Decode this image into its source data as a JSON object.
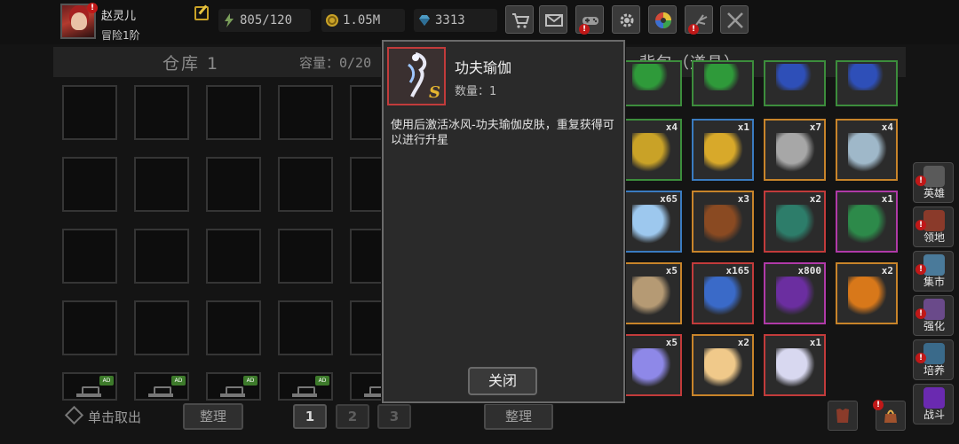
{
  "player": {
    "name": "赵灵儿",
    "rank": "冒险1阶"
  },
  "resources": {
    "stamina": "805/120",
    "gold": "1.05M",
    "gems": "3313"
  },
  "top_buttons": [
    "shop-cart-icon",
    "mail-icon",
    "gamepad-icon",
    "gear-icon",
    "color-wheel-icon",
    "fireworks-icon",
    "crossed-swords-icon"
  ],
  "warehouse": {
    "title": "仓库 1",
    "capacity_label": "容量：0/20",
    "take_out_hint": "单击取出",
    "sort_label": "整理",
    "pages": [
      "1",
      "2",
      "3"
    ],
    "ad_tag": "AD"
  },
  "backpack": {
    "title": "背包（道具）",
    "sort_label": "整理",
    "items": [
      {
        "qty": "",
        "icon": "green-gem-icon",
        "color": "#3c8d3c"
      },
      {
        "qty": "",
        "icon": "green-gem-icon",
        "color": "#3c8d3c"
      },
      {
        "qty": "",
        "icon": "blue-gem-icon",
        "color": "#3c8d3c"
      },
      {
        "qty": "",
        "icon": "blue-gem-icon",
        "color": "#3c8d3c"
      },
      {
        "qty": "x4",
        "icon": "gold-block-icon",
        "color": "#3c8d3c"
      },
      {
        "qty": "x1",
        "icon": "gold-diamond-icon",
        "color": "#3a7bc0"
      },
      {
        "qty": "x7",
        "icon": "grey-feather-icon",
        "color": "#c8842a"
      },
      {
        "qty": "x4",
        "icon": "silver-amulet-icon",
        "color": "#c8842a"
      },
      {
        "qty": "x65",
        "icon": "ice-crystal-icon",
        "color": "#3a7bc0"
      },
      {
        "qty": "x3",
        "icon": "brown-boots-icon",
        "color": "#c8842a"
      },
      {
        "qty": "x2",
        "icon": "green-boots-icon",
        "color": "#c23b3b"
      },
      {
        "qty": "x1",
        "icon": "teal-boots-icon",
        "color": "#b03aa8"
      },
      {
        "qty": "x5",
        "icon": "scroll-icon",
        "color": "#c8842a"
      },
      {
        "qty": "x165",
        "icon": "blue-rune-icon",
        "color": "#c23b3b"
      },
      {
        "qty": "x800",
        "icon": "purple-orb-icon",
        "color": "#b03aa8"
      },
      {
        "qty": "x2",
        "icon": "fire-orb-icon",
        "color": "#c8842a"
      },
      {
        "qty": "x5",
        "icon": "star-shard-icon",
        "color": "#c23b3b"
      },
      {
        "qty": "x2",
        "icon": "egg-icon",
        "color": "#c8842a"
      },
      {
        "qty": "x1",
        "icon": "skin-card-icon",
        "color": "#c23b3b"
      }
    ]
  },
  "side_nav": [
    {
      "label": "英雄",
      "icon": "knight-helmet-icon"
    },
    {
      "label": "领地",
      "icon": "castle-icon"
    },
    {
      "label": "集市",
      "icon": "market-stall-icon"
    },
    {
      "label": "强化",
      "icon": "anvil-icon"
    },
    {
      "label": "培养",
      "icon": "potion-icon"
    },
    {
      "label": "战斗",
      "icon": "portal-icon"
    }
  ],
  "modal": {
    "item_name": "功夫瑜伽",
    "quantity": "数量：1",
    "grade_letter": "S",
    "description": "使用后激活冰风-功夫瑜伽皮肤，重复获得可以进行升星",
    "close_label": "关闭"
  },
  "colors": {
    "rare_red": "#c23b3b",
    "epic_purple": "#b03aa8",
    "legend_orange": "#c8842a",
    "common_green": "#3c8d3c",
    "blue": "#3a7bc0",
    "alert_red": "#c01818"
  }
}
